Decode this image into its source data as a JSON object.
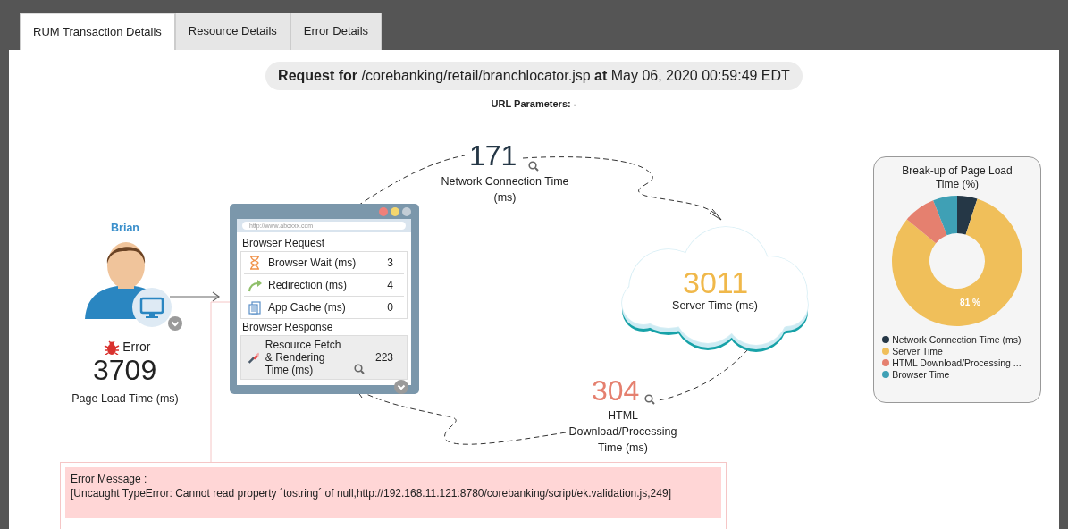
{
  "tabs": [
    {
      "label": "RUM Transaction Details",
      "selected": true
    },
    {
      "label": "Resource Details",
      "selected": false
    },
    {
      "label": "Error Details",
      "selected": false
    }
  ],
  "request_title": "**Request for** /corebanking/retail/branchlocator.jsp **at** May 06, 2020 00:59:49 EDT",
  "url_parameters": "URL Parameters: -",
  "user": {
    "name": "Brian",
    "status": "Error",
    "page_load_time": "3709",
    "page_load_label": "Page Load Time (ms)"
  },
  "browser": {
    "address": "http://www.abcxxx.com",
    "sections": [
      {
        "title": "Browser Request",
        "shaded": false,
        "rows": [
          {
            "kind": "hourglass",
            "label": "Browser Wait (ms)",
            "value": "3"
          },
          {
            "kind": "redirect",
            "label": "Redirection (ms)",
            "value": "4"
          },
          {
            "kind": "cache",
            "label": "App Cache (ms)",
            "value": "0"
          }
        ]
      },
      {
        "title": "Browser Response",
        "shaded": true,
        "rows": [
          {
            "kind": "brush",
            "label": "Resource Fetch & Rendering Time (ms)",
            "value": "223"
          }
        ]
      }
    ]
  },
  "network": {
    "value": "171",
    "label": "Network Connection Time (ms)"
  },
  "server": {
    "value": "3011",
    "label": "Server Time (ms)"
  },
  "html": {
    "value": "304",
    "label": "HTML Download/Processing Time (ms)"
  },
  "breakup": {
    "chart_data": {
      "type": "donut",
      "title": "Break-up of Page Load Time (%)",
      "categories": [
        "Network Connection Time (ms)",
        "Server Time",
        "HTML Download/Processing ...",
        "Browser Time"
      ],
      "colors": [
        "#253746",
        "#f0bf5a",
        "#e5806f",
        "#3fa0b5"
      ],
      "values": [
        5,
        81,
        8,
        6
      ],
      "value_labels": [
        null,
        "81 %",
        null,
        null
      ]
    }
  },
  "error_message": {
    "title": "Error Message :",
    "text": "[Uncaught TypeError: Cannot read property ´tostring´ of null,http://192.168.11.121:8780/corebanking/script/ek.validation.js,249]"
  }
}
